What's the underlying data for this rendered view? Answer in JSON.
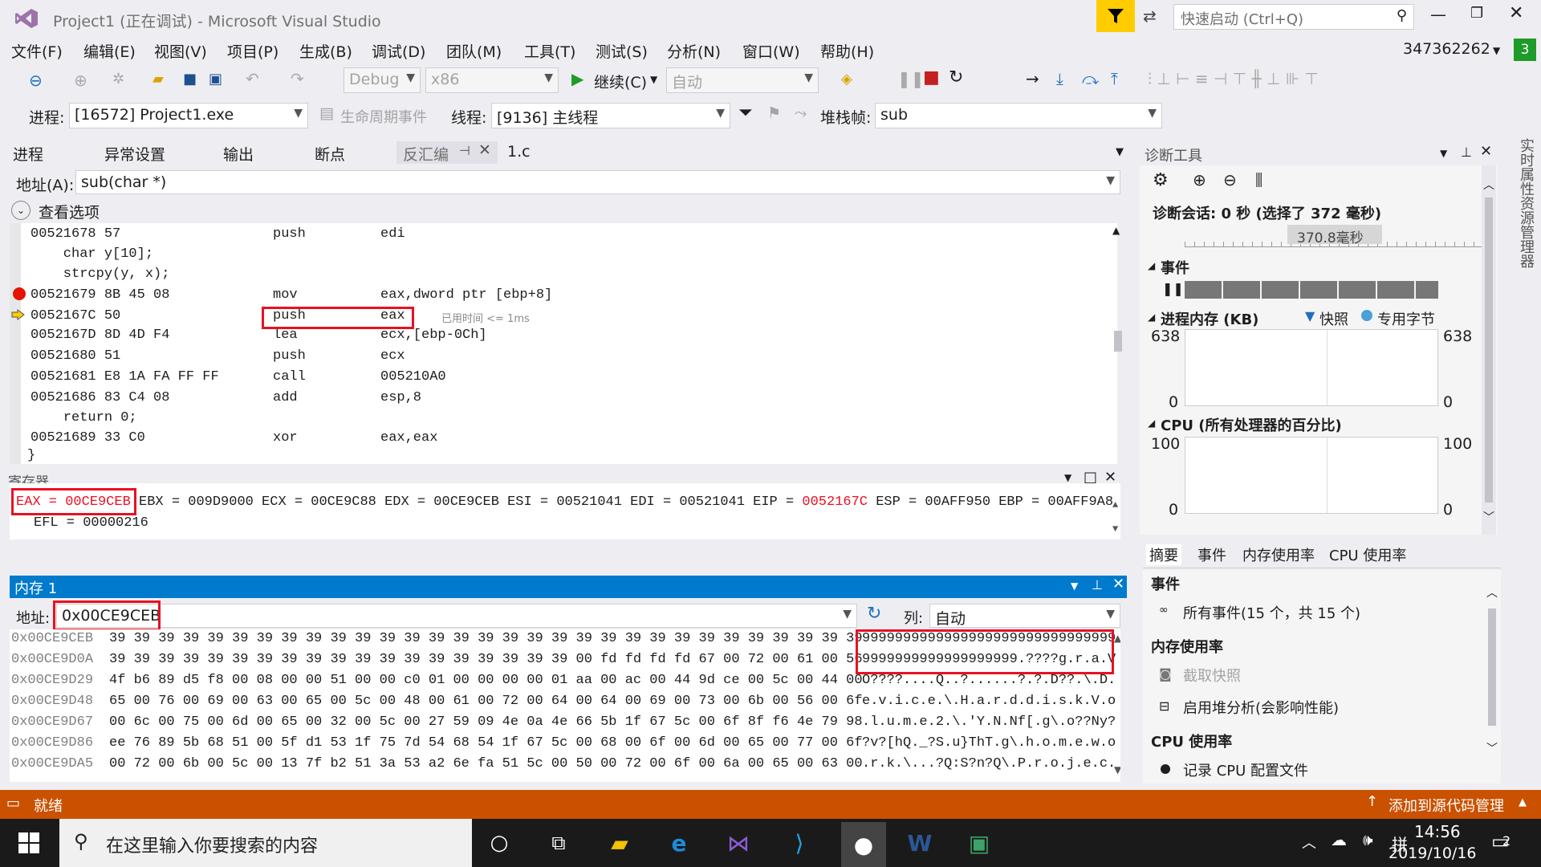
{
  "titlebar": {
    "title": "Project1 (正在调试) - Microsoft Visual Studio",
    "quick_launch": "快速启动 (Ctrl+Q)"
  },
  "menus": [
    "文件(F)",
    "编辑(E)",
    "视图(V)",
    "项目(P)",
    "生成(B)",
    "调试(D)",
    "团队(M)",
    "工具(T)",
    "测试(S)",
    "分析(N)",
    "窗口(W)",
    "帮助(H)"
  ],
  "account": {
    "id": "347362262",
    "badge": "3"
  },
  "toolbar": {
    "config": "Debug",
    "platform": "x86",
    "continue": "继续(C)",
    "auto": "自动"
  },
  "debugbar": {
    "process_label": "进程:",
    "process": "[16572] Project1.exe",
    "lifecycle": "生命周期事件",
    "thread_label": "线程:",
    "thread": "[9136] 主线程",
    "stack_label": "堆栈帧:",
    "stack": "sub"
  },
  "tabs": [
    "进程",
    "异常设置",
    "输出",
    "断点",
    "反汇编",
    "1.c"
  ],
  "disasm": {
    "addr_label": "地址(A):",
    "addr": "sub(char *)",
    "view_options": "查看选项",
    "lines": [
      {
        "addr": "00521678",
        "bytes": "57",
        "op": "push",
        "args": "edi"
      },
      {
        "src": "    char y[10];"
      },
      {
        "src": "    strcpy(y, x);"
      },
      {
        "addr": "00521679",
        "bytes": "8B 45 08",
        "op": "mov",
        "args": "eax,dword ptr [ebp+8]"
      },
      {
        "addr": "0052167C",
        "bytes": "50",
        "op": "push",
        "args": "eax",
        "note": "已用时间 <= 1ms"
      },
      {
        "addr": "0052167D",
        "bytes": "8D 4D F4",
        "op": "lea",
        "args": "ecx,[ebp-0Ch]"
      },
      {
        "addr": "00521680",
        "bytes": "51",
        "op": "push",
        "args": "ecx"
      },
      {
        "addr": "00521681",
        "bytes": "E8 1A FA FF FF",
        "op": "call",
        "args": "005210A0"
      },
      {
        "addr": "00521686",
        "bytes": "83 C4 08",
        "op": "add",
        "args": "esp,8"
      },
      {
        "src": "    return 0;"
      },
      {
        "addr": "00521689",
        "bytes": "33 C0",
        "op": "xor",
        "args": "eax,eax"
      },
      {
        "src": "}"
      }
    ]
  },
  "registers": {
    "title": "寄存器",
    "eax": "EAX = 00CE9CEB",
    "line1_mid": "EBX = 009D9000 ECX = 00CE9C88 EDX = 00CE9CEB ESI = 00521041 EDI = 00521041 EIP = ",
    "eip": "0052167C",
    "line1_end": " ESP = 00AFF950 EBP = 00AFF9A8",
    "line2": "EFL = 00000216"
  },
  "memory": {
    "title": "内存 1",
    "addr_label": "地址:",
    "addr": "0x00CE9CEB",
    "col_label": "列:",
    "col": "自动",
    "rows": [
      {
        "a": "0x00CE9CEB",
        "h": "39 39 39 39 39 39 39 39 39 39 39 39 39 39 39 39 39 39 39 39 39 39 39 39 39 39 39 39 39 39 39",
        "t": "9999999999999999999999999999999"
      },
      {
        "a": "0x00CE9D0A",
        "h": "39 39 39 39 39 39 39 39 39 39 39 39 39 39 39 39 39 39 39 00 fd fd fd fd 67 00 72 00 61 00 56",
        "t": "9999999999999999999.????g.r.a.V"
      },
      {
        "a": "0x00CE9D29",
        "h": "4f b6 89 d5 f8 00 08 00 00 51 00 00 c0 01 00 00 00 00 01 aa 00 ac 00 44 9d ce 00 5c 00 44 00",
        "t": "O????....Q..?......?.?.D??.\\.D."
      },
      {
        "a": "0x00CE9D48",
        "h": "65 00 76 00 69 00 63 00 65 00 5c 00 48 00 61 00 72 00 64 00 64 00 69 00 73 00 6b 00 56 00 6f",
        "t": "e.v.i.c.e.\\.H.a.r.d.d.i.s.k.V.o"
      },
      {
        "a": "0x00CE9D67",
        "h": "00 6c 00 75 00 6d 00 65 00 32 00 5c 00 27 59 09 4e 0a 4e 66 5b 1f 67 5c 00 6f 8f f6 4e 79 98",
        "t": ".l.u.m.e.2.\\.'Y.N.Nf[.g\\.o??Ny?"
      },
      {
        "a": "0x00CE9D86",
        "h": "ee 76 89 5b 68 51 00 5f d1 53 1f 75 7d 54 68 54 1f 67 5c 00 68 00 6f 00 6d 00 65 00 77 00 6f",
        "t": "?v?[hQ._?S.u}ThT.g\\.h.o.m.e.w.o"
      },
      {
        "a": "0x00CE9DA5",
        "h": "00 72 00 6b 00 5c 00 13 7f b2 51 3a 53 a2 6e fa 51 5c 00 50 00 72 00 6f 00 6a 00 65 00 63 00",
        "t": ".r.k.\\...?Q:S?n?Q\\.P.r.o.j.e.c."
      }
    ]
  },
  "diag": {
    "title": "诊断工具",
    "session": "诊断会话: 0 秒 (选择了 372 毫秒)",
    "timeline": "370.8毫秒",
    "events": "事件",
    "proc_mem": "进程内存 (KB)",
    "snapshot": "快照",
    "private": "专用字节",
    "mem_max": "638",
    "mem_min": "0",
    "cpu": "CPU (所有处理器的百分比)",
    "cpu_max": "100",
    "cpu_min": "0",
    "subtabs": [
      "摘要",
      "事件",
      "内存使用率",
      "CPU 使用率"
    ],
    "sec_events": "事件",
    "all_events": "所有事件(15 个，共 15 个)",
    "sec_mem": "内存使用率",
    "take_snapshot": "截取快照",
    "heap": "启用堆分析(会影响性能)",
    "sec_cpu": "CPU 使用率",
    "cpu_profile": "记录 CPU 配置文件",
    "side": "实时属性资源管理器"
  },
  "status": {
    "ready": "就绪",
    "source": "添加到源代码管理"
  },
  "taskbar": {
    "search": "在这里输入你要搜索的内容",
    "time": "14:56",
    "date": "2019/10/16",
    "notify": "2"
  },
  "colors": {
    "accent": "#007acc",
    "status": "#ca5100",
    "highlight": "#e81123",
    "changed": "#e81123",
    "marker": "#ffcc00"
  }
}
